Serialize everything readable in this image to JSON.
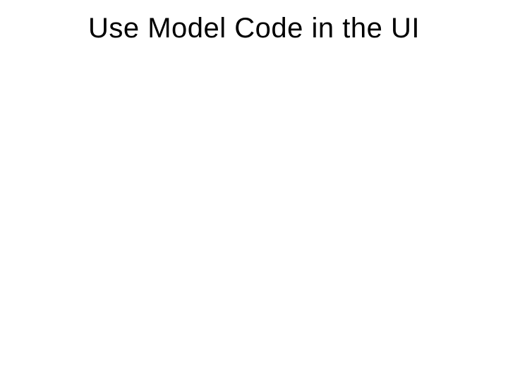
{
  "slide": {
    "title": "Use Model Code in the UI"
  }
}
